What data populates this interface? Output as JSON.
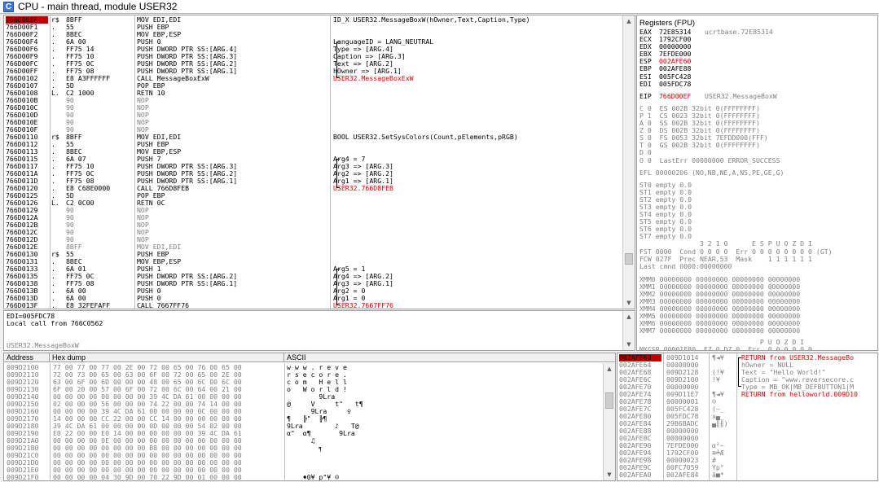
{
  "window": {
    "title": "CPU - main thread, module USER32",
    "icon_letter": "C"
  },
  "disasm": {
    "rows": [
      {
        "addr": "766D00EF",
        "m": "r$",
        "hex": "8BFF",
        "ins": "MOV EDI,EDI",
        "cmt": "ID_X USER32.MessageBoxW(hOwner,Text,Caption,Type)",
        "sel": true
      },
      {
        "addr": "766D00F1",
        "m": ".",
        "hex": "55",
        "ins": "PUSH EBP",
        "cmt": ""
      },
      {
        "addr": "766D00F2",
        "m": ".",
        "hex": "8BEC",
        "ins": "MOV EBP,ESP",
        "cmt": ""
      },
      {
        "addr": "766D00F4",
        "m": ".",
        "hex": "6A 00",
        "ins": "PUSH 0",
        "cmt": "LanguageID = LANG_NEUTRAL"
      },
      {
        "addr": "766D00F6",
        "m": ".",
        "hex": "FF75 14",
        "ins": "PUSH DWORD PTR SS:[ARG.4]",
        "cmt": "Type => [ARG.4]"
      },
      {
        "addr": "766D00F9",
        "m": ".",
        "hex": "FF75 10",
        "ins": "PUSH DWORD PTR SS:[ARG.3]",
        "cmt": "Caption => [ARG.3]"
      },
      {
        "addr": "766D00FC",
        "m": ".",
        "hex": "FF75 0C",
        "ins": "PUSH DWORD PTR SS:[ARG.2]",
        "cmt": "Text => [ARG.2]"
      },
      {
        "addr": "766D00FF",
        "m": ".",
        "hex": "FF75 08",
        "ins": "PUSH DWORD PTR SS:[ARG.1]",
        "cmt": "hOwner => [ARG.1]"
      },
      {
        "addr": "766D0102",
        "m": ".",
        "hex": "E8 A3FFFFFF",
        "ins": "CALL MessageBoxExW",
        "cmt": "USER32.MessageBoxExW",
        "red": true
      },
      {
        "addr": "766D0107",
        "m": ".",
        "hex": "5D",
        "ins": "POP EBP",
        "cmt": ""
      },
      {
        "addr": "766D0108",
        "m": "L.",
        "hex": "C2 1000",
        "ins": "RETN 10",
        "cmt": ""
      },
      {
        "addr": "766D010B",
        "m": "",
        "hex": "90",
        "ins": "NOP",
        "cmt": "",
        "g": true
      },
      {
        "addr": "766D010C",
        "m": "",
        "hex": "90",
        "ins": "NOP",
        "cmt": "",
        "g": true
      },
      {
        "addr": "766D010D",
        "m": "",
        "hex": "90",
        "ins": "NOP",
        "cmt": "",
        "g": true
      },
      {
        "addr": "766D010E",
        "m": "",
        "hex": "90",
        "ins": "NOP",
        "cmt": "",
        "g": true
      },
      {
        "addr": "766D010F",
        "m": "",
        "hex": "90",
        "ins": "NOP",
        "cmt": "",
        "g": true
      },
      {
        "addr": "766D0110",
        "m": "r$",
        "hex": "8BFF",
        "ins": "MOV EDI,EDI",
        "cmt": "BOOL USER32.SetSysColors(Count,pElements,pRGB)"
      },
      {
        "addr": "766D0112",
        "m": ".",
        "hex": "55",
        "ins": "PUSH EBP",
        "cmt": ""
      },
      {
        "addr": "766D0113",
        "m": ".",
        "hex": "8BEC",
        "ins": "MOV EBP,ESP",
        "cmt": ""
      },
      {
        "addr": "766D0115",
        "m": ".",
        "hex": "6A 07",
        "ins": "PUSH 7",
        "cmt": "Arg4 = 7"
      },
      {
        "addr": "766D0117",
        "m": ".",
        "hex": "FF75 10",
        "ins": "PUSH DWORD PTR SS:[ARG.3]",
        "cmt": "Arg3 => [ARG.3]"
      },
      {
        "addr": "766D011A",
        "m": ".",
        "hex": "FF75 0C",
        "ins": "PUSH DWORD PTR SS:[ARG.2]",
        "cmt": "Arg2 => [ARG.2]"
      },
      {
        "addr": "766D011D",
        "m": ".",
        "hex": "FF75 08",
        "ins": "PUSH DWORD PTR SS:[ARG.1]",
        "cmt": "Arg1 => [ARG.1]"
      },
      {
        "addr": "766D0120",
        "m": ".",
        "hex": "E8 C68E0000",
        "ins": "CALL 766D8FEB",
        "cmt": "USER32.766D8FEB",
        "red": true
      },
      {
        "addr": "766D0125",
        "m": ".",
        "hex": "5D",
        "ins": "POP EBP",
        "cmt": ""
      },
      {
        "addr": "766D0126",
        "m": "L.",
        "hex": "C2 0C00",
        "ins": "RETN 0C",
        "cmt": ""
      },
      {
        "addr": "766D0129",
        "m": "",
        "hex": "90",
        "ins": "NOP",
        "cmt": "",
        "g": true
      },
      {
        "addr": "766D012A",
        "m": "",
        "hex": "90",
        "ins": "NOP",
        "cmt": "",
        "g": true
      },
      {
        "addr": "766D012B",
        "m": "",
        "hex": "90",
        "ins": "NOP",
        "cmt": "",
        "g": true
      },
      {
        "addr": "766D012C",
        "m": "",
        "hex": "90",
        "ins": "NOP",
        "cmt": "",
        "g": true
      },
      {
        "addr": "766D012D",
        "m": "",
        "hex": "90",
        "ins": "NOP",
        "cmt": "",
        "g": true
      },
      {
        "addr": "766D012E",
        "m": "",
        "hex": "8BFF",
        "ins": "MOV EDI,EDI",
        "cmt": "",
        "g": true
      },
      {
        "addr": "766D0130",
        "m": "r$",
        "hex": "55",
        "ins": "PUSH EBP",
        "cmt": ""
      },
      {
        "addr": "766D0131",
        "m": ".",
        "hex": "8BEC",
        "ins": "MOV EBP,ESP",
        "cmt": ""
      },
      {
        "addr": "766D0133",
        "m": ".",
        "hex": "6A 01",
        "ins": "PUSH 1",
        "cmt": "Arg5 = 1"
      },
      {
        "addr": "766D0135",
        "m": ".",
        "hex": "FF75 0C",
        "ins": "PUSH DWORD PTR SS:[ARG.2]",
        "cmt": "Arg4 => [ARG.2]"
      },
      {
        "addr": "766D0138",
        "m": ".",
        "hex": "FF75 08",
        "ins": "PUSH DWORD PTR SS:[ARG.1]",
        "cmt": "Arg3 => [ARG.1]"
      },
      {
        "addr": "766D013B",
        "m": ".",
        "hex": "6A 00",
        "ins": "PUSH 0",
        "cmt": "Arg2 = 0"
      },
      {
        "addr": "766D013D",
        "m": ".",
        "hex": "6A 00",
        "ins": "PUSH 0",
        "cmt": "Arg1 = 0"
      },
      {
        "addr": "766D013F",
        "m": ".",
        "hex": "E8 32FEFAFF",
        "ins": "CALL 7667FF76",
        "cmt": "USER32.7667FF76",
        "red": true
      }
    ]
  },
  "info": {
    "line1": "EDI=005FDC78",
    "line2": "Local call from 766C0562",
    "line3": "USER32.MessageBoxW"
  },
  "registers": {
    "title": "Registers (FPU)",
    "gp": [
      {
        "n": "EAX",
        "v": "72E85314",
        "c": "ucrtbase.72E85314"
      },
      {
        "n": "ECX",
        "v": "1792CF00",
        "c": ""
      },
      {
        "n": "EDX",
        "v": "00000000",
        "c": ""
      },
      {
        "n": "EBX",
        "v": "7EFDE000",
        "c": ""
      },
      {
        "n": "ESP",
        "v": "002AFE60",
        "c": "",
        "red": true
      },
      {
        "n": "EBP",
        "v": "002AFE88",
        "c": ""
      },
      {
        "n": "ESI",
        "v": "005FC428",
        "c": ""
      },
      {
        "n": "EDI",
        "v": "005FDC78",
        "c": ""
      }
    ],
    "eip": {
      "n": "EIP",
      "v": "766D00EF",
      "c": "USER32.MessageBoxW"
    },
    "seg": [
      "C 0  ES 002B 32bit 0(FFFFFFFF)",
      "P 1  CS 0023 32bit 0(FFFFFFFF)",
      "A 0  SS 002B 32bit 0(FFFFFFFF)",
      "Z 0  DS 002B 32bit 0(FFFFFFFF)",
      "S 0  FS 0053 32bit 7EFDD000(FFF)",
      "T 0  GS 002B 32bit 0(FFFFFFFF)",
      "D 0",
      "O 0  LastErr 00000000 ERROR_SUCCESS"
    ],
    "efl": "EFL 00000206 (NO,NB,NE,A,NS,PE,GE,G)",
    "st": [
      "ST0 empty 0.0",
      "ST1 empty 0.0",
      "ST2 empty 0.0",
      "ST3 empty 0.0",
      "ST4 empty 0.0",
      "ST5 empty 0.0",
      "ST6 empty 0.0",
      "ST7 empty 0.0"
    ],
    "fpu": [
      "               3 2 1 0      E S P U O Z D I",
      "FST 0000  Cond 0 0 0 0  Err 0 0 0 0 0 0 0 0 (GT)",
      "FCW 027F  Prec NEAR,53  Mask    1 1 1 1 1 1",
      "Last cmnd 0000:00000000"
    ],
    "xmm": [
      "XMM0 00000000 00000000 00000000 00000000",
      "XMM1 00000000 00000000 00000000 00000000",
      "XMM2 00000000 00000000 00000000 00000000",
      "XMM3 00000000 00000000 00000000 00000000",
      "XMM4 00000000 00000000 00000000 00000000",
      "XMM5 00000000 00000000 00000000 00000000",
      "XMM6 00000000 00000000 00000000 00000000",
      "XMM7 00000000 00000000 00000000 00000000"
    ],
    "mxcsr": [
      "                              P U O Z D I",
      "MXCSR 00001F80  FZ 0 DZ 0  Err  0 0 0 0 0 0",
      "                Rnd NEAR   Mask  1 1 1 1 1 1"
    ]
  },
  "dump": {
    "headers": [
      "Address",
      "Hex dump",
      "ASCII"
    ],
    "rows": [
      {
        "a": "009D2100",
        "h": "77 00 77 00 77 00 2E 00 72 00 65 00 76 00 65 00",
        "s": "w w w . r e v e"
      },
      {
        "a": "009D2110",
        "h": "72 00 73 00 65 00 63 00 6F 00 72 00 65 00 2E 00",
        "s": "r s e c o r e ."
      },
      {
        "a": "009D2120",
        "h": "63 00 6F 00 6D 00 00 00 48 00 65 00 6C 00 6C 00",
        "s": "c o m   H e l l"
      },
      {
        "a": "009D2130",
        "h": "6F 00 20 00 57 00 6F 00 72 00 6C 00 64 00 21 00",
        "s": "o   W o r l d !"
      },
      {
        "a": "009D2140",
        "h": "00 00 00 00 00 00 00 00 39 4C DA 61 00 00 00 00",
        "s": "        9Lra"
      },
      {
        "a": "009D2150",
        "h": "02 00 00 00 56 00 00 00 74 22 00 00 74 14 00 00",
        "s": "@     V     t\"   t¶"
      },
      {
        "a": "009D2160",
        "h": "00 00 00 00 39 4C DA 61 00 00 00 00 0C 00 00 00",
        "s": "      9Lra     ♀"
      },
      {
        "a": "009D2170",
        "h": "14 00 00 00 CC 22 00 00 CC 14 00 00 00 00 00 00",
        "s": "¶   ╠\"  ╠¶"
      },
      {
        "a": "009D2180",
        "h": "39 4C DA 61 00 00 00 00 0D 00 00 00 54 02 00 00",
        "s": "9Lra        ♪   T@"
      },
      {
        "a": "009D2190",
        "h": "E0 22 00 00 E0 14 00 00 00 00 00 00 39 4C DA 61",
        "s": "α\"  α¶       9Lra"
      },
      {
        "a": "009D21A0",
        "h": "00 00 00 00 0E 00 00 00 00 00 00 00 00 00 00 00",
        "s": "      ♫"
      },
      {
        "a": "009D21B0",
        "h": "00 00 00 00 00 00 00 00 B8 00 00 00 00 00 00 00",
        "s": "        ╕"
      },
      {
        "a": "009D21C0",
        "h": "00 00 00 00 00 00 00 00 00 00 00 00 00 00 00 00",
        "s": ""
      },
      {
        "a": "009D21D0",
        "h": "00 00 00 00 00 00 00 00 00 00 00 00 00 00 00 00",
        "s": ""
      },
      {
        "a": "009D21E0",
        "h": "00 00 00 00 00 00 00 00 00 00 00 00 00 00 00 00",
        "s": ""
      },
      {
        "a": "009D21F0",
        "h": "00 00 00 00 04 30 9D 00 70 22 9D 00 01 00 00 00",
        "s": "    ♦0¥ p\"¥ ☺"
      }
    ]
  },
  "stack": {
    "rows": [
      {
        "a": "002AFE60",
        "v": "009D1014",
        "m": "¶◄¥",
        "c": "RETURN from USER32.MessageBo",
        "sel": true,
        "red": true,
        "br": "r"
      },
      {
        "a": "002AFE64",
        "v": "00000000",
        "m": "",
        "c": "hOwner = NULL",
        "br": "|"
      },
      {
        "a": "002AFE68",
        "v": "009D2128",
        "m": "(!¥",
        "c": "Text = \"Hello World!\"",
        "br": "|"
      },
      {
        "a": "002AFE6C",
        "v": "009D2100",
        "m": "!¥",
        "c": "Caption = \"www.reversecore.c",
        "br": "|"
      },
      {
        "a": "002AFE70",
        "v": "00000000",
        "m": "",
        "c": "Type = MB_OK|MB_DEFBUTTON1|M",
        "br": "L"
      },
      {
        "a": "002AFE74",
        "v": "009D11E7",
        "m": "¶◄¥",
        "c": "RETURN from helloworld.009D10",
        "red": true
      },
      {
        "a": "002AFE78",
        "v": "00000001",
        "m": "☺",
        "c": ""
      },
      {
        "a": "002AFE7C",
        "v": "005FC428",
        "m": "(–_",
        "c": ""
      },
      {
        "a": "002AFE80",
        "v": "005FDC78",
        "m": "x▄_",
        "c": ""
      },
      {
        "a": "002AFE84",
        "v": "29B6BADC",
        "m": "▄║╢)",
        "c": ""
      },
      {
        "a": "002AFE88",
        "v": "00000000",
        "m": "",
        "c": ""
      },
      {
        "a": "002AFE8C",
        "v": "00000000",
        "m": "",
        "c": ""
      },
      {
        "a": "002AFE90",
        "v": "7EFDE000",
        "m": "α²~",
        "c": ""
      },
      {
        "a": "002AFE94",
        "v": "1792CF00",
        "m": "≡╧Æ",
        "c": ""
      },
      {
        "a": "002AFE98",
        "v": "00000023",
        "m": "#",
        "c": ""
      },
      {
        "a": "002AFE9C",
        "v": "00FC7059",
        "m": "Yp°",
        "c": ""
      },
      {
        "a": "002AFEA0",
        "v": "002AFE84",
        "m": "ä■*",
        "c": ""
      }
    ]
  }
}
